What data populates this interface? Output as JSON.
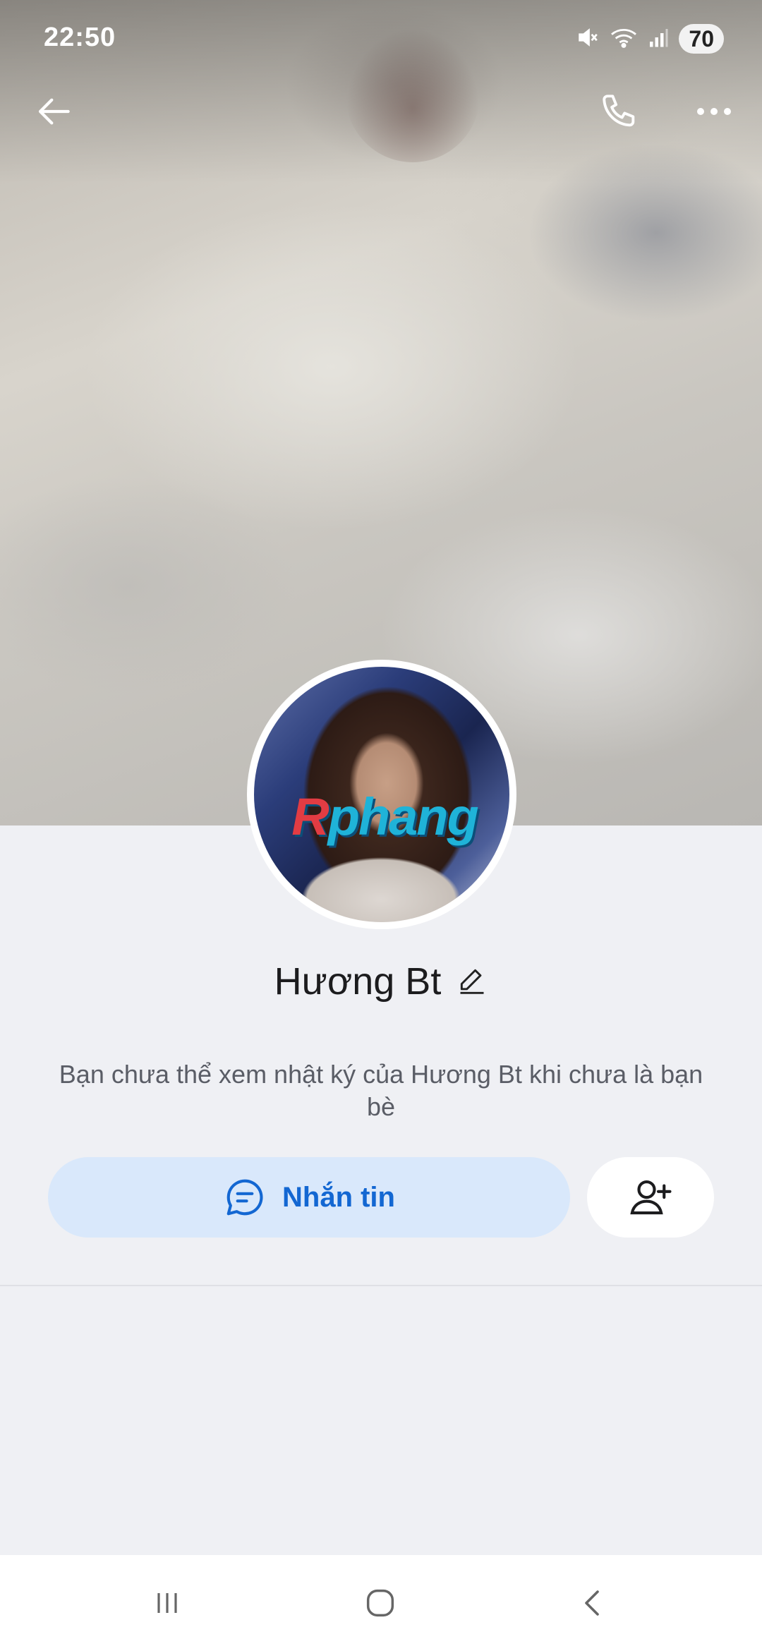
{
  "status_bar": {
    "time": "22:50",
    "battery": "70"
  },
  "icons": {
    "back": "arrow-left-icon",
    "call": "phone-icon",
    "more": "more-horizontal-icon",
    "edit": "pencil-icon",
    "message": "chat-bubble-icon",
    "add_friend": "add-user-icon"
  },
  "avatar": {
    "watermark": "Rphang"
  },
  "profile": {
    "name": "Hương Bt",
    "notice": "Bạn chưa thể xem nhật ký của Hương Bt khi chưa là bạn bè"
  },
  "actions": {
    "message_label": "Nhắn tin"
  },
  "colors": {
    "accent": "#1367d2",
    "message_button_bg": "#d9e8fb",
    "page_bg": "#eff0f4"
  }
}
